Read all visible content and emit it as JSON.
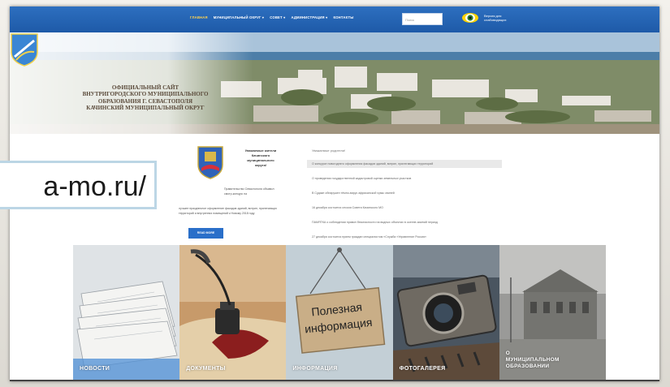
{
  "url_overlay": "a-mo.ru/",
  "nav": {
    "items": [
      "ГЛАВНАЯ",
      "МУНИЦИПАЛЬНЫЙ ОКРУГ ▾",
      "СОВЕТ ▾",
      "АДМИНИСТРАЦИЯ ▾",
      "КОНТАКТЫ"
    ],
    "active_index": 0,
    "search_placeholder": "Поиск",
    "vision_label": "Версия для слабовидящих"
  },
  "hero": {
    "title_lines": [
      "ОФИЦИАЛЬНЫЙ САЙТ",
      "ВНУТРИГОРОДСКОГО МУНИЦИПАЛЬНОГО",
      "ОБРАЗОВАНИЯ Г. СЕВАСТОПОЛЯ",
      "КАЧИНСКИЙ МУНИЦИПАЛЬНЫЙ ОКРУГ"
    ]
  },
  "greeting": {
    "title_lines": [
      "Уважаемые жители",
      "Качинского",
      "муниципального",
      "округа!"
    ],
    "paragraph": "Правительство Севастополя объявил смотр-конкурс на",
    "paragraph2": "лучшее праздничное оформление фасадов зданий, витрин, прилегающих территорий и внутренних помещений к Новому 2018 году",
    "read_more": "READ MORE"
  },
  "notices": {
    "heading": "Уважаемые родители!",
    "items": [
      "О конкурсе новогоднего оформления фасадов зданий, витрин, прилегающих территорий",
      "О проведении государственной кадастровой оценки земельных участков",
      "В Судаке обнаружен тёмно-вирус африканской чумы свиней",
      "16 декабря состоится сессия Совета Качинского МО",
      "ПАМЯТКА о соблюдении правил безопасности на водных объектах в осенне-зимний период",
      "27 декабря состоится прием граждан специалистом «Служба «Управление Россия»"
    ],
    "active_index": 0
  },
  "tiles": [
    {
      "label": "НОВОСТИ"
    },
    {
      "label": "ДОКУМЕНТЫ"
    },
    {
      "label": "ИНФОРМАЦИЯ",
      "sign_lines": [
        "Полезная",
        "информация"
      ]
    },
    {
      "label": "ФОТОГАЛЕРЕЯ"
    },
    {
      "label_lines": [
        "О",
        "МУНИЦИПАЛЬНОМ",
        "ОБРАЗОВАНИИ"
      ]
    }
  ],
  "colors": {
    "nav_bg": "#1e5aa8",
    "nav_active": "#ffd34d",
    "button": "#2a6fc9",
    "title_text": "#5a4a3a"
  }
}
